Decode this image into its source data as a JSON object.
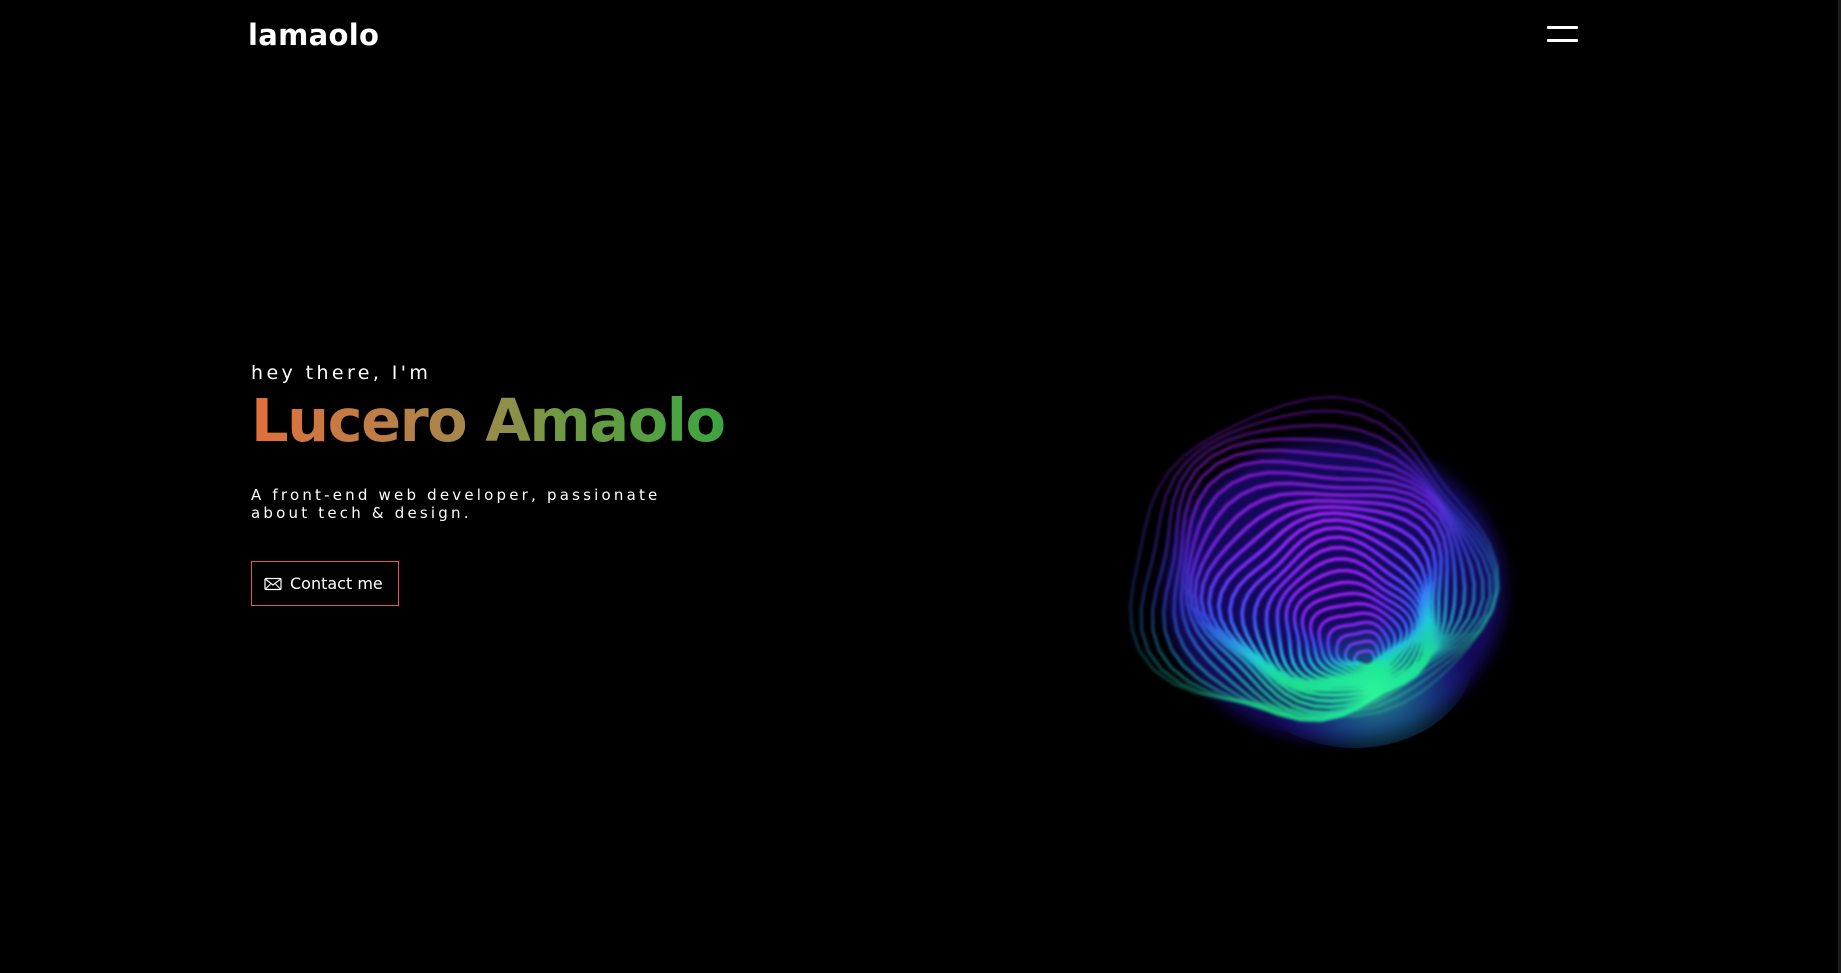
{
  "header": {
    "logo_text": "lamaolo",
    "menu_icon": "hamburger-menu-icon"
  },
  "hero": {
    "greeting": "hey there, I'm",
    "name": "Lucero Amaolo",
    "tagline": "A front-end web developer, passionate about tech & design.",
    "contact_button": {
      "label": "Contact me",
      "icon": "mail-icon"
    }
  },
  "colors": {
    "background": "#000000",
    "text": "#ffffff",
    "name_gradient_start": "#e0703c",
    "name_gradient_end": "#2ea83e",
    "button_border": "#e25560",
    "blob_top": "#a020f0",
    "blob_mid": "#3a4cff",
    "blob_bottom": "#1cf08a"
  },
  "decoration": {
    "blob_icon": "iridescent-contour-blob"
  }
}
